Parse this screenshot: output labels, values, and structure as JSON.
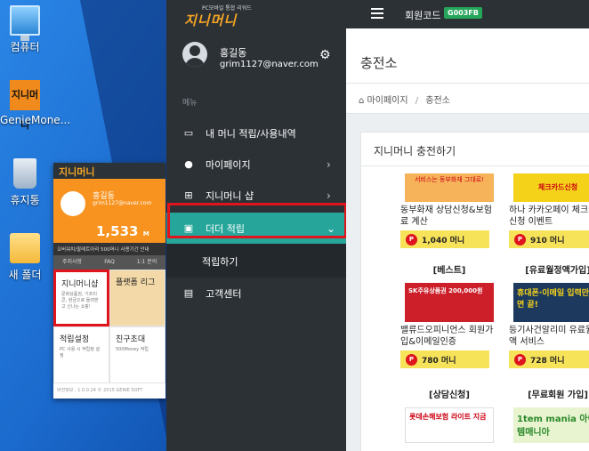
{
  "desktop": {
    "icons": [
      {
        "label": "컴퓨터",
        "icon": "computer-icon"
      },
      {
        "label": "GenieMone...",
        "icon": "app-icon"
      },
      {
        "label": "휴지통",
        "icon": "recycle-bin-icon"
      },
      {
        "label": "새 폴더",
        "icon": "folder-icon"
      }
    ],
    "app_icon_text": "지니머니"
  },
  "preview": {
    "logo": "지니머니",
    "name": "홍길동",
    "email": "grim1127@naver.com",
    "money": "1,533",
    "money_unit": "M",
    "notice": "오버워치/팔레트아리 500머니 사용기간 안내",
    "tabs": [
      "주지사항",
      "FAQ",
      "1:1 문의"
    ],
    "cells": [
      {
        "title": "지니머니샵",
        "desc": "문화상품권, 기프티콘, 현금으로 돌려받고 신나는 쇼핑!"
      },
      {
        "title": "플랫폼 리그",
        "desc": ""
      },
      {
        "title": "적립설정",
        "desc": "PC 사용 시 적립정 설정"
      },
      {
        "title": "친구초대",
        "desc": "500Money 적립"
      }
    ],
    "footer": "버전정보 : 1.0.0.24      © 2015 GENIE SOFT"
  },
  "topbar": {
    "logo_sub": "PC모바일 통합 리워드",
    "logo": "지니머니",
    "member_label": "회원코드",
    "member_code": "G003FB"
  },
  "sidebar": {
    "name": "홍길동",
    "email": "grim1127@naver.com",
    "section": "메뉴",
    "items": [
      {
        "label": "내 머니 적립/사용내역",
        "icon": "wallet-icon"
      },
      {
        "label": "마이페이지",
        "icon": "user-icon"
      },
      {
        "label": "지니머니 샵",
        "icon": "gift-icon"
      },
      {
        "label": "더더 적립",
        "icon": "battery-icon"
      },
      {
        "label": "고객센터",
        "icon": "chat-icon"
      }
    ],
    "sub_item": "적립하기"
  },
  "main": {
    "title": "충전소",
    "breadcrumb": [
      "마이페이지",
      "충전소"
    ],
    "panel_title": "지니머니 충전하기",
    "products": [
      {
        "tag": "",
        "name": "동부화재 상담신청&보험료 계산",
        "price": "1,040 머니",
        "banner": "서비스는 동부화재 그대로!",
        "color": "#f6b35a"
      },
      {
        "tag": "",
        "name": "하나 카카오페이 체크카드 신청 이벤트",
        "price": "910 머니",
        "banner": "체크카드신청",
        "color": "#f5d21a"
      },
      {
        "tag": "[베스트]",
        "name": "밸류드오피니언스 회원가입&이메일인증",
        "price": "780 머니",
        "banner": "SK주유상품권 200,000원",
        "color": "#cc1f2a"
      },
      {
        "tag": "[유료월정액가입]",
        "name": "등기사건알리미 유료월정액 서비스",
        "price": "728 머니",
        "banner": "휴대폰·이메일 입력만하면 끝!",
        "color": "#1d3a5e"
      },
      {
        "tag": "[상담신청]",
        "name": "",
        "price": "",
        "banner": "롯데손해보험 라이트 지금",
        "color": "#ffffff"
      },
      {
        "tag": "[무료회원 가입]",
        "name": "",
        "price": "",
        "banner": "1tem mania 아이템매니아",
        "color": "#e8f3d0"
      }
    ]
  },
  "colors": {
    "sidebar_bg": "#2c3136",
    "accent_teal": "#26a69a",
    "highlight_red": "#e0141c",
    "badge_green": "#26a65b",
    "logo_orange": "#f6a623"
  }
}
